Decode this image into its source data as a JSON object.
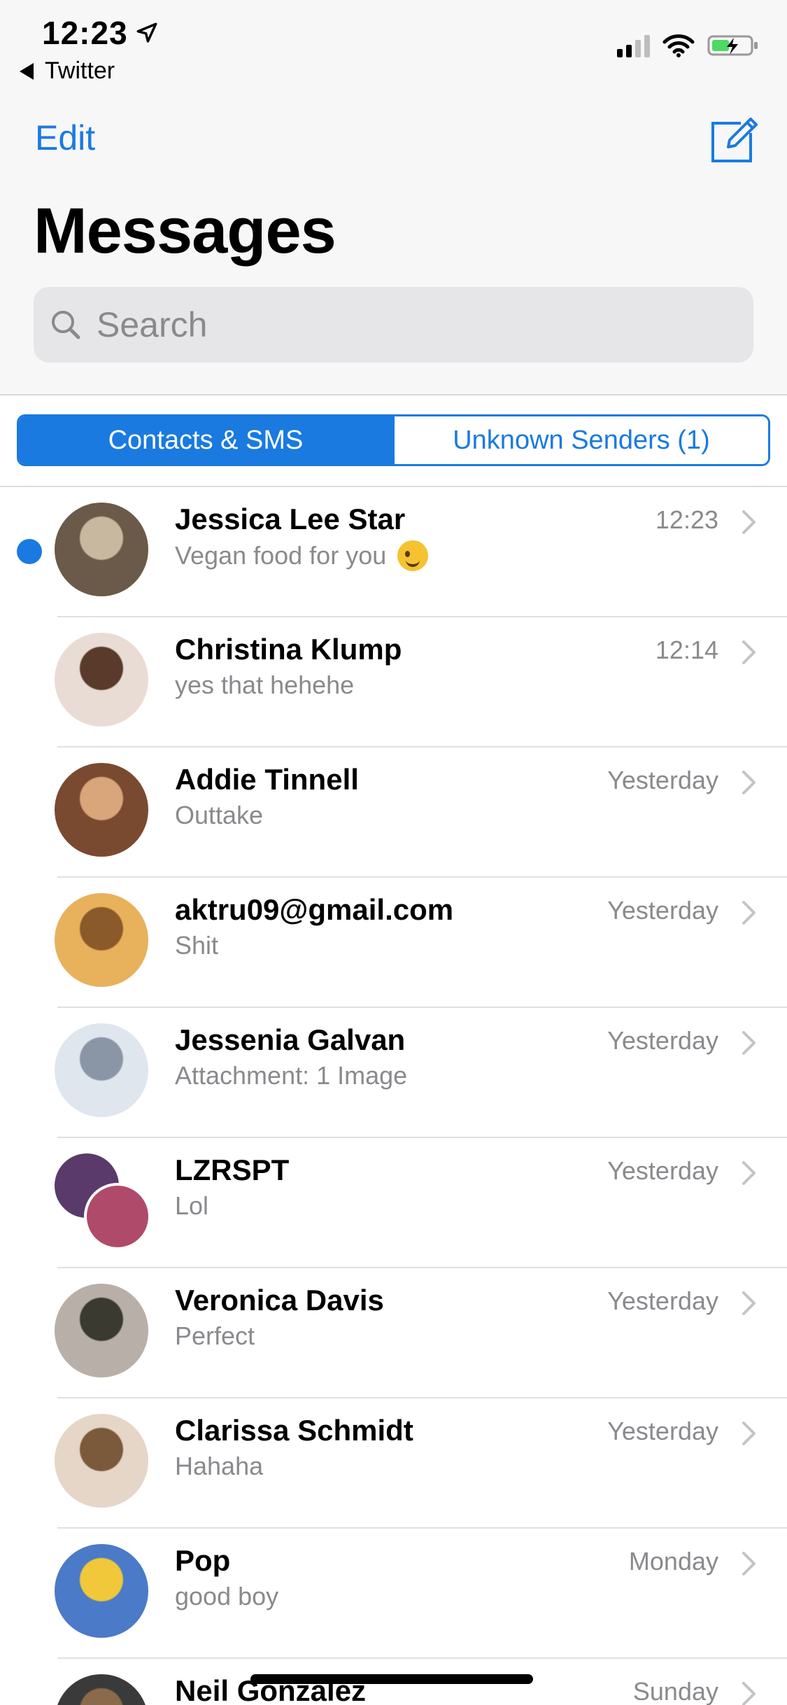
{
  "status_bar": {
    "time": "12:23",
    "back_app": "Twitter",
    "battery_color": "#4cd964"
  },
  "nav": {
    "edit_label": "Edit",
    "title": "Messages",
    "compose_icon": "compose-icon"
  },
  "search": {
    "placeholder": "Search"
  },
  "segments": {
    "active": "Contacts & SMS",
    "inactive": "Unknown Senders (1)"
  },
  "accent_color": "#1a7ae0",
  "conversations": [
    {
      "name": "Jessica Lee Star",
      "preview": "Vegan food for you",
      "time": "12:23",
      "unread": true,
      "avatar_colors": [
        "#6b5a4a",
        "#c9b8a0"
      ]
    },
    {
      "name": "Christina Klump",
      "preview": "yes that hehehe",
      "time": "12:14",
      "unread": false,
      "avatar_colors": [
        "#e9dcd4",
        "#5a3a2a"
      ]
    },
    {
      "name": "Addie Tinnell",
      "preview": "Outtake",
      "time": "Yesterday",
      "unread": false,
      "avatar_colors": [
        "#7a4a30",
        "#d9a57a"
      ]
    },
    {
      "name": "aktru09@gmail.com",
      "preview": "Shit",
      "time": "Yesterday",
      "unread": false,
      "avatar_colors": [
        "#e8b15c",
        "#8a5a2a"
      ]
    },
    {
      "name": "Jessenia Galvan",
      "preview": "Attachment: 1 Image",
      "time": "Yesterday",
      "unread": false,
      "avatar_colors": [
        "#dfe6ee",
        "#8a96a6"
      ]
    },
    {
      "name": "LZRSPT",
      "preview": "Lol",
      "time": "Yesterday",
      "unread": false,
      "avatar_colors": [
        "#5a3a6a",
        "#b04a6a"
      ]
    },
    {
      "name": "Veronica Davis",
      "preview": "Perfect",
      "time": "Yesterday",
      "unread": false,
      "avatar_colors": [
        "#b8b0a8",
        "#3a3a30"
      ]
    },
    {
      "name": "Clarissa Schmidt",
      "preview": "Hahaha",
      "time": "Yesterday",
      "unread": false,
      "avatar_colors": [
        "#e6d6c8",
        "#7a5a3a"
      ]
    },
    {
      "name": "Pop",
      "preview": "good boy",
      "time": "Monday",
      "unread": false,
      "avatar_colors": [
        "#4a7ac8",
        "#f0c83a"
      ]
    },
    {
      "name": "Neil Gonzalez",
      "preview": "",
      "time": "Sunday",
      "unread": false,
      "avatar_colors": [
        "#3a3a3a",
        "#8a6a4a"
      ]
    }
  ]
}
